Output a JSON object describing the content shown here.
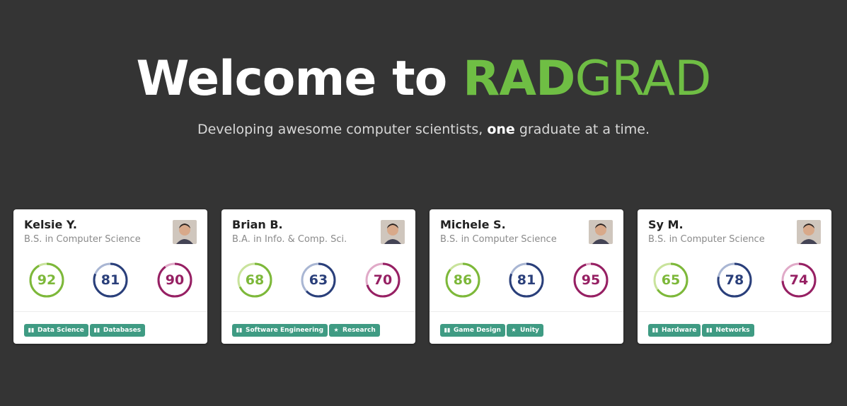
{
  "hero": {
    "welcome": "Welcome to",
    "brand_rad": "RAD",
    "brand_grad": "GRAD",
    "subtitle_pre": "Developing awesome computer scientists, ",
    "subtitle_bold": "one",
    "subtitle_post": " graduate at a time."
  },
  "colors": {
    "brand_green": "#6fbe44",
    "ring_green": "#7db83a",
    "ring_blue": "#2a3f7a",
    "ring_purple": "#962063",
    "tag_teal": "#3f9b83",
    "background": "#343434"
  },
  "cards": [
    {
      "name": "Kelsie Y.",
      "degree": "B.S. in Computer Science",
      "avatar": "avatar-photo",
      "levels": [
        92,
        81,
        90
      ],
      "tags": [
        {
          "label": "Data Science",
          "icon": "building-icon"
        },
        {
          "label": "Databases",
          "icon": "building-icon"
        }
      ]
    },
    {
      "name": "Brian B.",
      "degree": "B.A. in Info. & Comp. Sci.",
      "avatar": "avatar-photo",
      "levels": [
        68,
        63,
        70
      ],
      "tags": [
        {
          "label": "Software Engineering",
          "icon": "building-icon"
        },
        {
          "label": "Research",
          "icon": "star-icon"
        }
      ]
    },
    {
      "name": "Michele S.",
      "degree": "B.S. in Computer Science",
      "avatar": "avatar-photo",
      "levels": [
        86,
        81,
        95
      ],
      "tags": [
        {
          "label": "Game Design",
          "icon": "building-icon"
        },
        {
          "label": "Unity",
          "icon": "star-icon"
        }
      ]
    },
    {
      "name": "Sy M.",
      "degree": "B.S. in Computer Science",
      "avatar": "avatar-photo",
      "levels": [
        65,
        78,
        74
      ],
      "tags": [
        {
          "label": "Hardware",
          "icon": "building-icon"
        },
        {
          "label": "Networks",
          "icon": "building-icon"
        }
      ]
    }
  ]
}
